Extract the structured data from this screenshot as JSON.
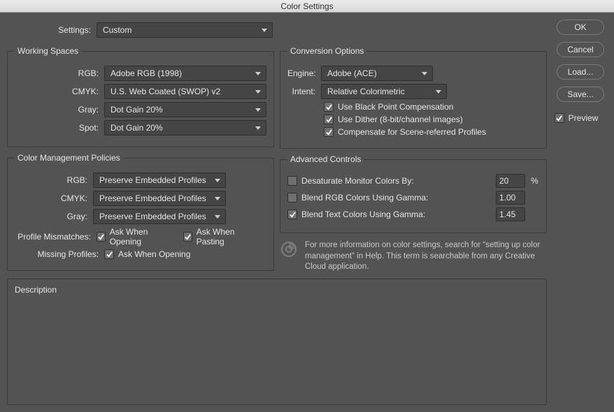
{
  "window": {
    "title": "Color Settings"
  },
  "settings": {
    "label": "Settings:",
    "value": "Custom"
  },
  "working_spaces": {
    "legend": "Working Spaces",
    "rgb": {
      "label": "RGB:",
      "value": "Adobe RGB (1998)"
    },
    "cmyk": {
      "label": "CMYK:",
      "value": "U.S. Web Coated (SWOP) v2"
    },
    "gray": {
      "label": "Gray:",
      "value": "Dot Gain 20%"
    },
    "spot": {
      "label": "Spot:",
      "value": "Dot Gain 20%"
    }
  },
  "policies": {
    "legend": "Color Management Policies",
    "rgb": {
      "label": "RGB:",
      "value": "Preserve Embedded Profiles"
    },
    "cmyk": {
      "label": "CMYK:",
      "value": "Preserve Embedded Profiles"
    },
    "gray": {
      "label": "Gray:",
      "value": "Preserve Embedded Profiles"
    },
    "mismatches": {
      "label": "Profile Mismatches:",
      "ask_open": "Ask When Opening",
      "ask_paste": "Ask When Pasting"
    },
    "missing": {
      "label": "Missing Profiles:",
      "ask_open": "Ask When Opening"
    }
  },
  "conversion": {
    "legend": "Conversion Options",
    "engine": {
      "label": "Engine:",
      "value": "Adobe (ACE)"
    },
    "intent": {
      "label": "Intent:",
      "value": "Relative Colorimetric"
    },
    "bpc": {
      "label": "Use Black Point Compensation"
    },
    "dither": {
      "label": "Use Dither (8-bit/channel images)"
    },
    "scene": {
      "label": "Compensate for Scene-referred Profiles"
    }
  },
  "advanced": {
    "legend": "Advanced Controls",
    "desaturate": {
      "label": "Desaturate Monitor Colors By:",
      "value": "20",
      "unit": "%"
    },
    "blend_rgb": {
      "label": "Blend RGB Colors Using Gamma:",
      "value": "1.00"
    },
    "blend_text": {
      "label": "Blend Text Colors Using Gamma:",
      "value": "1.45"
    }
  },
  "info": {
    "text": "For more information on color settings, search for “setting up color management” in Help. This term is searchable from any Creative Cloud application."
  },
  "description": {
    "legend": "Description"
  },
  "buttons": {
    "ok": "OK",
    "cancel": "Cancel",
    "load": "Load...",
    "save": "Save..."
  },
  "preview": {
    "label": "Preview"
  }
}
